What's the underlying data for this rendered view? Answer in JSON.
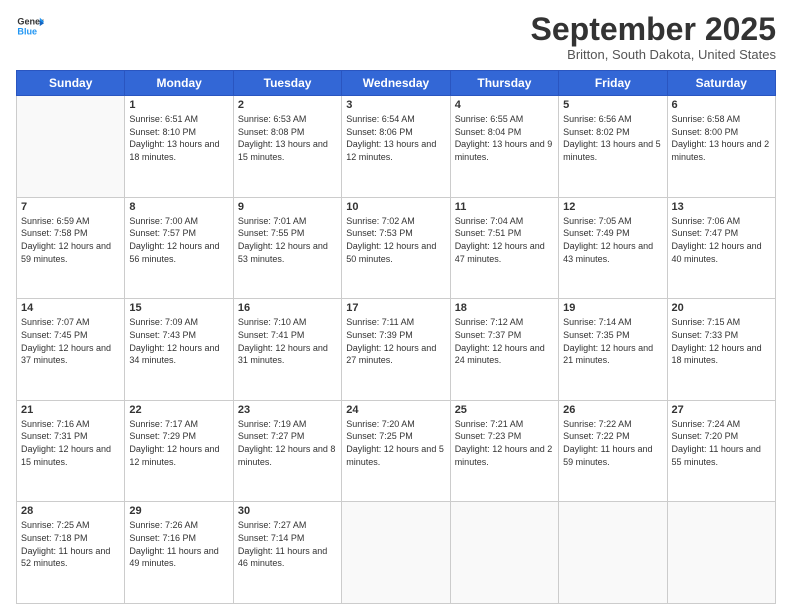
{
  "logo": {
    "general": "General",
    "blue": "Blue"
  },
  "title": "September 2025",
  "location": "Britton, South Dakota, United States",
  "days_of_week": [
    "Sunday",
    "Monday",
    "Tuesday",
    "Wednesday",
    "Thursday",
    "Friday",
    "Saturday"
  ],
  "weeks": [
    [
      {
        "day": "",
        "sunrise": "",
        "sunset": "",
        "daylight": ""
      },
      {
        "day": "1",
        "sunrise": "Sunrise: 6:51 AM",
        "sunset": "Sunset: 8:10 PM",
        "daylight": "Daylight: 13 hours and 18 minutes."
      },
      {
        "day": "2",
        "sunrise": "Sunrise: 6:53 AM",
        "sunset": "Sunset: 8:08 PM",
        "daylight": "Daylight: 13 hours and 15 minutes."
      },
      {
        "day": "3",
        "sunrise": "Sunrise: 6:54 AM",
        "sunset": "Sunset: 8:06 PM",
        "daylight": "Daylight: 13 hours and 12 minutes."
      },
      {
        "day": "4",
        "sunrise": "Sunrise: 6:55 AM",
        "sunset": "Sunset: 8:04 PM",
        "daylight": "Daylight: 13 hours and 9 minutes."
      },
      {
        "day": "5",
        "sunrise": "Sunrise: 6:56 AM",
        "sunset": "Sunset: 8:02 PM",
        "daylight": "Daylight: 13 hours and 5 minutes."
      },
      {
        "day": "6",
        "sunrise": "Sunrise: 6:58 AM",
        "sunset": "Sunset: 8:00 PM",
        "daylight": "Daylight: 13 hours and 2 minutes."
      }
    ],
    [
      {
        "day": "7",
        "sunrise": "Sunrise: 6:59 AM",
        "sunset": "Sunset: 7:58 PM",
        "daylight": "Daylight: 12 hours and 59 minutes."
      },
      {
        "day": "8",
        "sunrise": "Sunrise: 7:00 AM",
        "sunset": "Sunset: 7:57 PM",
        "daylight": "Daylight: 12 hours and 56 minutes."
      },
      {
        "day": "9",
        "sunrise": "Sunrise: 7:01 AM",
        "sunset": "Sunset: 7:55 PM",
        "daylight": "Daylight: 12 hours and 53 minutes."
      },
      {
        "day": "10",
        "sunrise": "Sunrise: 7:02 AM",
        "sunset": "Sunset: 7:53 PM",
        "daylight": "Daylight: 12 hours and 50 minutes."
      },
      {
        "day": "11",
        "sunrise": "Sunrise: 7:04 AM",
        "sunset": "Sunset: 7:51 PM",
        "daylight": "Daylight: 12 hours and 47 minutes."
      },
      {
        "day": "12",
        "sunrise": "Sunrise: 7:05 AM",
        "sunset": "Sunset: 7:49 PM",
        "daylight": "Daylight: 12 hours and 43 minutes."
      },
      {
        "day": "13",
        "sunrise": "Sunrise: 7:06 AM",
        "sunset": "Sunset: 7:47 PM",
        "daylight": "Daylight: 12 hours and 40 minutes."
      }
    ],
    [
      {
        "day": "14",
        "sunrise": "Sunrise: 7:07 AM",
        "sunset": "Sunset: 7:45 PM",
        "daylight": "Daylight: 12 hours and 37 minutes."
      },
      {
        "day": "15",
        "sunrise": "Sunrise: 7:09 AM",
        "sunset": "Sunset: 7:43 PM",
        "daylight": "Daylight: 12 hours and 34 minutes."
      },
      {
        "day": "16",
        "sunrise": "Sunrise: 7:10 AM",
        "sunset": "Sunset: 7:41 PM",
        "daylight": "Daylight: 12 hours and 31 minutes."
      },
      {
        "day": "17",
        "sunrise": "Sunrise: 7:11 AM",
        "sunset": "Sunset: 7:39 PM",
        "daylight": "Daylight: 12 hours and 27 minutes."
      },
      {
        "day": "18",
        "sunrise": "Sunrise: 7:12 AM",
        "sunset": "Sunset: 7:37 PM",
        "daylight": "Daylight: 12 hours and 24 minutes."
      },
      {
        "day": "19",
        "sunrise": "Sunrise: 7:14 AM",
        "sunset": "Sunset: 7:35 PM",
        "daylight": "Daylight: 12 hours and 21 minutes."
      },
      {
        "day": "20",
        "sunrise": "Sunrise: 7:15 AM",
        "sunset": "Sunset: 7:33 PM",
        "daylight": "Daylight: 12 hours and 18 minutes."
      }
    ],
    [
      {
        "day": "21",
        "sunrise": "Sunrise: 7:16 AM",
        "sunset": "Sunset: 7:31 PM",
        "daylight": "Daylight: 12 hours and 15 minutes."
      },
      {
        "day": "22",
        "sunrise": "Sunrise: 7:17 AM",
        "sunset": "Sunset: 7:29 PM",
        "daylight": "Daylight: 12 hours and 12 minutes."
      },
      {
        "day": "23",
        "sunrise": "Sunrise: 7:19 AM",
        "sunset": "Sunset: 7:27 PM",
        "daylight": "Daylight: 12 hours and 8 minutes."
      },
      {
        "day": "24",
        "sunrise": "Sunrise: 7:20 AM",
        "sunset": "Sunset: 7:25 PM",
        "daylight": "Daylight: 12 hours and 5 minutes."
      },
      {
        "day": "25",
        "sunrise": "Sunrise: 7:21 AM",
        "sunset": "Sunset: 7:23 PM",
        "daylight": "Daylight: 12 hours and 2 minutes."
      },
      {
        "day": "26",
        "sunrise": "Sunrise: 7:22 AM",
        "sunset": "Sunset: 7:22 PM",
        "daylight": "Daylight: 11 hours and 59 minutes."
      },
      {
        "day": "27",
        "sunrise": "Sunrise: 7:24 AM",
        "sunset": "Sunset: 7:20 PM",
        "daylight": "Daylight: 11 hours and 55 minutes."
      }
    ],
    [
      {
        "day": "28",
        "sunrise": "Sunrise: 7:25 AM",
        "sunset": "Sunset: 7:18 PM",
        "daylight": "Daylight: 11 hours and 52 minutes."
      },
      {
        "day": "29",
        "sunrise": "Sunrise: 7:26 AM",
        "sunset": "Sunset: 7:16 PM",
        "daylight": "Daylight: 11 hours and 49 minutes."
      },
      {
        "day": "30",
        "sunrise": "Sunrise: 7:27 AM",
        "sunset": "Sunset: 7:14 PM",
        "daylight": "Daylight: 11 hours and 46 minutes."
      },
      {
        "day": "",
        "sunrise": "",
        "sunset": "",
        "daylight": ""
      },
      {
        "day": "",
        "sunrise": "",
        "sunset": "",
        "daylight": ""
      },
      {
        "day": "",
        "sunrise": "",
        "sunset": "",
        "daylight": ""
      },
      {
        "day": "",
        "sunrise": "",
        "sunset": "",
        "daylight": ""
      }
    ]
  ]
}
